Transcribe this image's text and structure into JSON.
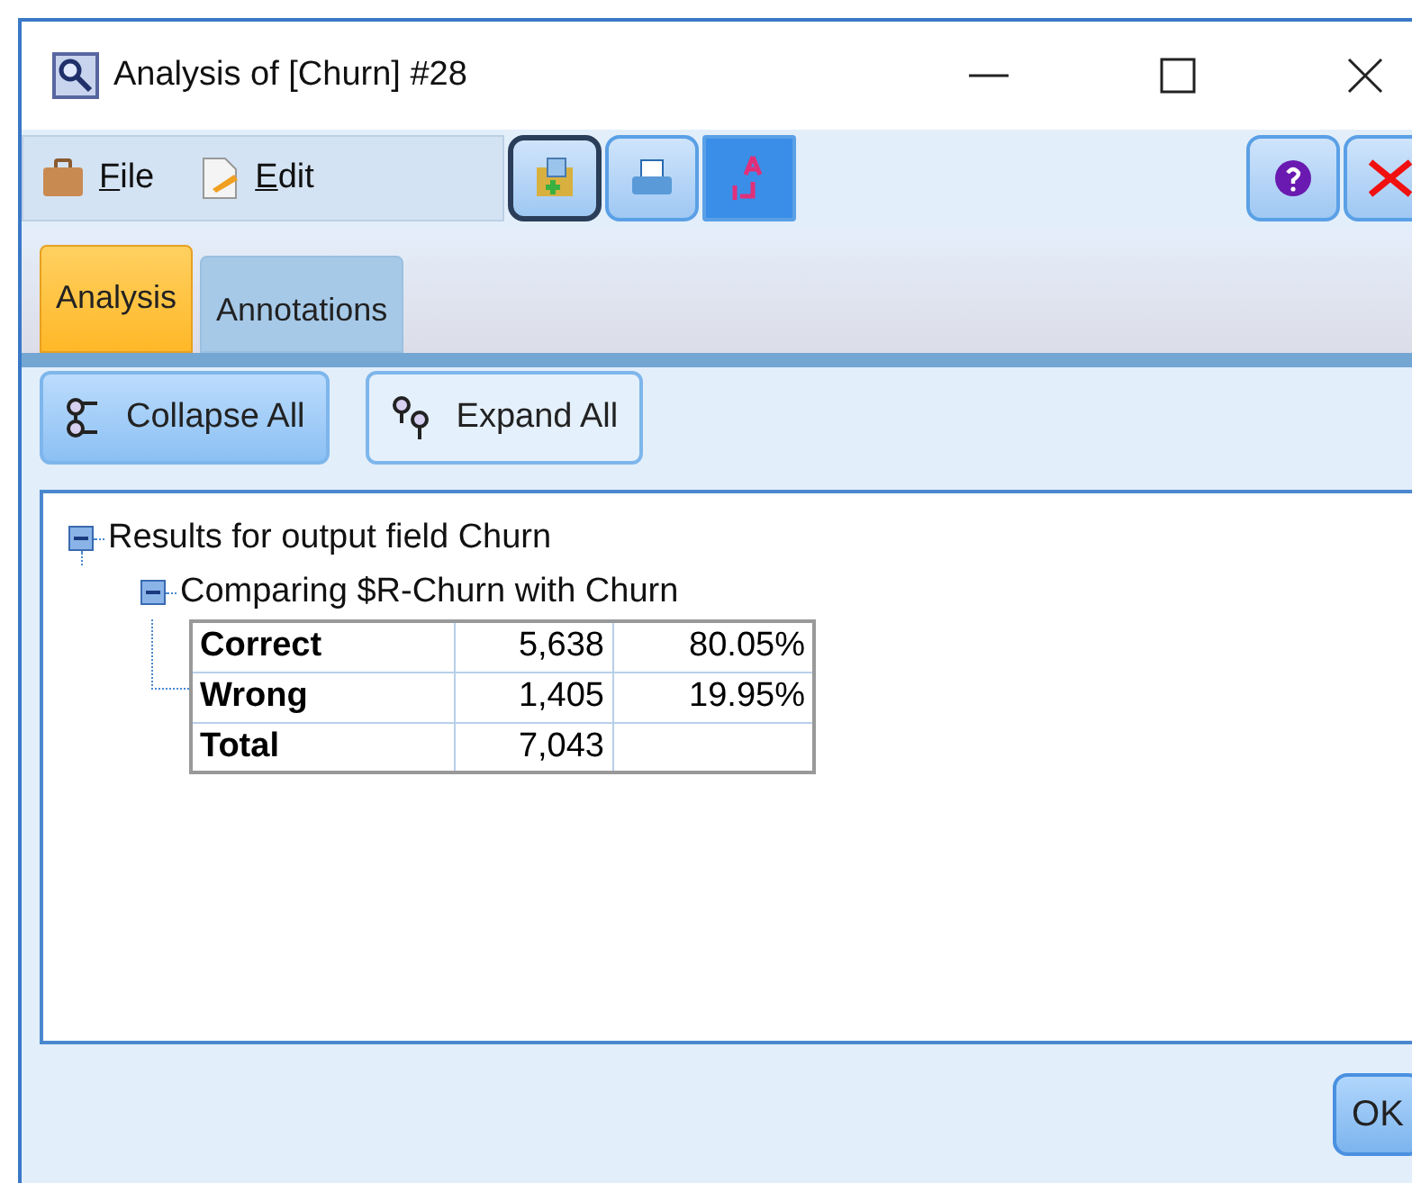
{
  "window": {
    "title": "Analysis of [Churn] #28"
  },
  "menu": [
    {
      "label": "File",
      "kind": "file"
    },
    {
      "label": "Edit",
      "kind": "edit"
    }
  ],
  "tabs": [
    {
      "label": "Analysis",
      "selected": true
    },
    {
      "label": "Annotations",
      "selected": false
    }
  ],
  "actions": [
    {
      "label": "Collapse All",
      "kind": "collapse",
      "selected": true
    },
    {
      "label": "Expand All",
      "kind": "expand",
      "selected": false
    }
  ],
  "tree": {
    "label": "Results for output field Churn",
    "expanded": true,
    "children": [
      {
        "label": "Comparing $R-Churn with Churn",
        "expanded": true,
        "table": [
          {
            "label": "Correct",
            "count": "5,638",
            "percent": "80.05%"
          },
          {
            "label": "Wrong",
            "count": "1,405",
            "percent": "19.95%"
          },
          {
            "label": "Total",
            "count": "7,043"
          }
        ]
      }
    ]
  },
  "buttons": [
    "OK"
  ]
}
